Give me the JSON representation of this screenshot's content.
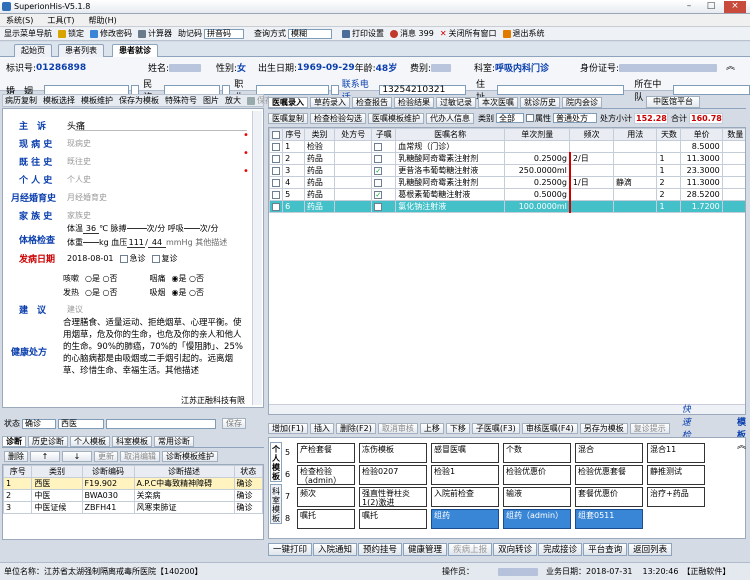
{
  "window": {
    "title": "SuperionHis-V5.1.8"
  },
  "menu": [
    "系统(S)",
    "工具(T)",
    "帮助(H)"
  ],
  "toolbar": {
    "items": [
      "显示菜单导航",
      "锁定",
      "修改密码",
      "计算器",
      "助记码"
    ],
    "input_method": "拼音码",
    "query_label": "查询方式",
    "query_mode": "模糊",
    "items2": [
      "打印设置",
      "消息"
    ],
    "msg_count": "399",
    "items3": [
      "关闭所有窗口",
      "退出系统"
    ]
  },
  "doc_tabs": [
    "起始页",
    "患者列表",
    "患者就诊"
  ],
  "patient": {
    "card_label": "标识号:",
    "card_no": "01286898",
    "name_label": "姓名:",
    "gender_label": "性别:",
    "gender": "女",
    "dob_label": "出生日期:",
    "dob": "1969-09-29",
    "age_label": "年龄:",
    "age": "48岁",
    "fee_label": "费别:",
    "dept_label": "科室:",
    "dept": "呼吸内科门诊",
    "id_label": "身份证号:",
    "marriage_label": "婚　姻",
    "nation_label": "民族",
    "job_label": "职业",
    "phone_label": "联系电话",
    "phone": "13254210321",
    "addr_label": "住址",
    "unit_label": "所在中队"
  },
  "record_toolbar": [
    "病历复制",
    "模板选择",
    "模板维护",
    "保存为模板",
    "特殊符号",
    "图片",
    "放大",
    "保存"
  ],
  "record": {
    "chief_label": "主　诉",
    "chief": "头痛",
    "present_label": "现 病 史",
    "present_ph": "现病史",
    "past_label": "既 往 史",
    "past_ph": "既往史",
    "personal_label": "个 人 史",
    "personal_ph": "个人史",
    "menstrual_label": "月经婚育史",
    "menstrual_ph": "月经婚育史",
    "family_label": "家 族 史",
    "family_ph": "家族史",
    "exam_label": "体格检查",
    "exam_line1": "体温",
    "temp": "36",
    "exam_unit1": "℃ 脉搏",
    "exam_unit2": "次/分 呼吸",
    "exam_unit3": "次/分",
    "exam_line2": "体重",
    "exam_unit4": "kg 血压",
    "bp1": "111",
    "bp2": "44",
    "exam_unit5": "mmHg 其他描述",
    "onset_label": "发病日期",
    "onset": "2018-08-01",
    "urgent": "急诊",
    "revisit": "复诊",
    "sym": [
      {
        "a": "咳嗽",
        "b": "咽痛"
      },
      {
        "a": "发热",
        "b": "吸烟"
      }
    ],
    "yes": "是",
    "no": "否",
    "advice_label": "建　议",
    "advice_ph": "建议",
    "health_label": "健康处方",
    "health_text": "合理膳食、适量运动、拒绝烟草、心理平衡。使用烟草，危及你的生命，也危及你的亲人和他人的生命。90%的肺癌，70%的「慢阻肺」、25%的心脑病都是由吸烟或二手烟引起的。远离烟草、珍惜生命、幸福生活。其他描述",
    "company": "江苏正融科技有限公司"
  },
  "status": {
    "label": "状态",
    "s1": "确诊",
    "s2": "西医",
    "save": "保存"
  },
  "diag_tabs": [
    "诊断",
    "历史诊断",
    "个人模板",
    "科室模板",
    "常用诊断"
  ],
  "diag_btns": [
    "删除",
    "↑",
    "↓",
    "更新",
    "取消编辑",
    "诊断模板维护"
  ],
  "diag_head": [
    "序号",
    "类别",
    "诊断编码",
    "诊断描述",
    "状态"
  ],
  "diag_rows": [
    [
      "1",
      "西医",
      "F19.902",
      "A.P.C中毒致精神障碍",
      "确诊"
    ],
    [
      "2",
      "中医",
      "BWA030",
      "关栾病",
      "确诊"
    ],
    [
      "3",
      "中医证候",
      "ZBFH41",
      "风寒束肺证",
      "确诊"
    ]
  ],
  "right_tabs": [
    "医嘱录入",
    "草药录入",
    "检查报告",
    "检验结果",
    "过敏记录",
    "本次医嘱",
    "就诊历史",
    "院内会诊"
  ],
  "platform": "中医馆平台",
  "rx_toolbar": [
    "医嘱复制",
    "检查检验勾选",
    "医嘱模板维护",
    "代办人信息"
  ],
  "rx_filter": {
    "type_label": "类别",
    "type": "全部",
    "attr_label": "属性",
    "attr": "普通处方",
    "subtotal_label": "处方小计",
    "subtotal": "152.28",
    "total_label": "合计",
    "total": "160.78"
  },
  "rx_head": [
    "序号",
    "类别",
    "处方号",
    "子嘱",
    "医嘱名称",
    "单次剂量",
    "频次",
    "用法",
    "天数",
    "单价",
    "数量"
  ],
  "rx_rows": [
    [
      "1",
      "检验",
      "",
      "",
      "血常规（门诊）",
      "",
      "",
      "",
      "",
      "8.5000",
      ""
    ],
    [
      "2",
      "药品",
      "",
      "",
      "乳糖酸阿奇霉素注射剂",
      "0.2500g",
      "2/日",
      "",
      "1",
      "11.3000",
      ""
    ],
    [
      "3",
      "药品",
      "",
      "✓",
      "更昔洛韦葡萄糖注射液",
      "250.0000ml",
      "",
      "",
      "1",
      "23.3000",
      ""
    ],
    [
      "4",
      "药品",
      "",
      "",
      "乳糖酸阿奇霉素注射剂",
      "0.2500g",
      "1/日",
      "静滴",
      "2",
      "11.3000",
      ""
    ],
    [
      "5",
      "药品",
      "",
      "✓",
      "葛根素葡萄糖注射液",
      "0.5000g",
      "",
      "",
      "2",
      "28.5200",
      ""
    ],
    [
      "6",
      "药品",
      "",
      "",
      "氯化钠注射液",
      "100.0000ml",
      "",
      "",
      "1",
      "1.7200",
      ""
    ]
  ],
  "op_btns": [
    "增加(F1)",
    "插入",
    "删除(F2)",
    "取消审核",
    "上移",
    "下移",
    "子医嘱(F3)",
    "审核医嘱(F4)",
    "另存为模板",
    "复诊提示"
  ],
  "quick": "快速检索",
  "tmpl_label": "模板",
  "tmpl_vtabs": [
    "个人模板",
    "科室模板"
  ],
  "tmpl_rows": [
    {
      "n": "5",
      "c": [
        "产检套餐",
        "冻伤模板",
        "感冒医嘱",
        "个数",
        "混合",
        "混合11"
      ]
    },
    {
      "n": "6",
      "c": [
        "检查检验（admin）",
        "检验0207",
        "检验1",
        "检验优惠价",
        "检验优惠套餐",
        "静推测试"
      ]
    },
    {
      "n": "7",
      "c": [
        "频次",
        "强直性脊柱炎1(2)激进",
        "入院前检查",
        "输液",
        "套餐优惠价",
        "治疗+药品"
      ]
    },
    {
      "n": "8",
      "c": [
        "嘱托",
        "嘱托",
        "组药",
        "组药（admin）",
        "组套0511",
        ""
      ]
    }
  ],
  "bottom_btns": [
    "一键打印",
    "入院通知",
    "预约挂号",
    "健康管理",
    "疾病上报",
    "双向转诊",
    "完成接诊",
    "平台查询",
    "返回列表"
  ],
  "statusbar": {
    "unit": "单位名称：江苏省太湖强制隔离戒毒所医院【140200】",
    "operator": "操作员：",
    "date_label": "业务日期：",
    "date": "2018-07-31",
    "time": "13:20:46",
    "company": "【正融软件】"
  },
  "colors": {
    "accent": "#0b3fae",
    "highlight": "#43c0c8",
    "red": "#cc0000",
    "template_blue": "#3a86d6"
  }
}
